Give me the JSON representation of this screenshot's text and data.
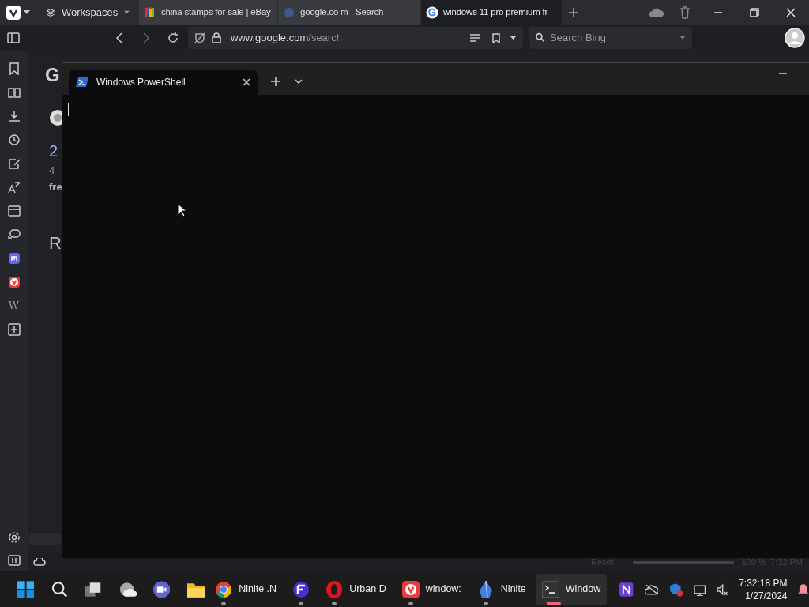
{
  "browser": {
    "workspaces": "Workspaces",
    "tabs": [
      {
        "title": "china stamps for sale | eBay",
        "selected": false,
        "kind": "ebay"
      },
      {
        "title": "google.co m - Search",
        "selected": false,
        "kind": "blank"
      },
      {
        "title": "windows 11 pro premium fr",
        "selected": true,
        "kind": "google"
      }
    ],
    "address": {
      "host": "www.google.com",
      "path": "/search"
    },
    "search": {
      "placeholder": "Search Bing"
    },
    "panel_glyph": "W",
    "page_fragments": [
      "G",
      "2",
      "4",
      "fre",
      "R"
    ],
    "status": {
      "reset": "Reset",
      "zoom": "100 %",
      "time": "7:32 PM"
    }
  },
  "terminal": {
    "tab_title": "Windows PowerShell"
  },
  "taskbar": {
    "apps": [
      {
        "kind": "chrome",
        "label": "Ninite .N"
      },
      {
        "kind": "fences"
      },
      {
        "kind": "opera",
        "label": "Urban D"
      },
      {
        "kind": "vivaldi",
        "label": "window:"
      },
      {
        "kind": "crystal",
        "label": "Ninite"
      },
      {
        "kind": "terminal",
        "label": "Window",
        "selected": true
      }
    ],
    "time": "7:32:18 PM",
    "date": "1/27/2024"
  }
}
